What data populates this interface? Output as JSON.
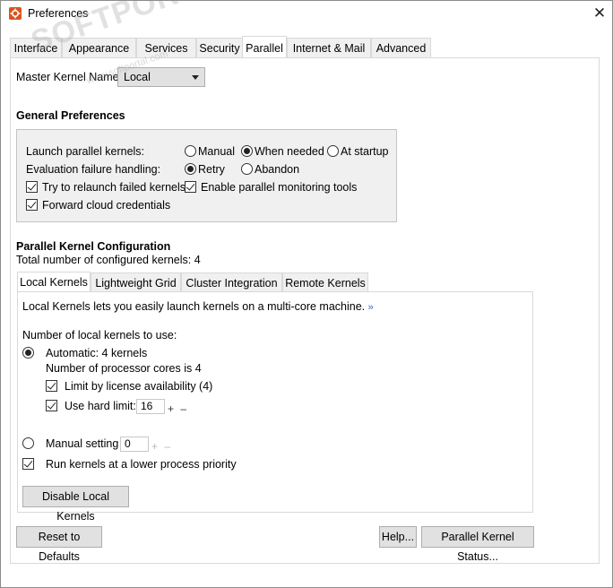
{
  "window": {
    "title": "Preferences",
    "close_glyph": "✕"
  },
  "tabs": [
    {
      "label": "Interface"
    },
    {
      "label": "Appearance"
    },
    {
      "label": "Services"
    },
    {
      "label": "Security"
    },
    {
      "label": "Parallel"
    },
    {
      "label": "Internet & Mail"
    },
    {
      "label": "Advanced"
    }
  ],
  "active_tab": "Parallel",
  "master_kernel": {
    "label": "Master Kernel Name:",
    "value": "Local"
  },
  "general": {
    "heading": "General Preferences",
    "launch_label": "Launch parallel kernels:",
    "launch_options": [
      "Manual",
      "When needed",
      "At startup"
    ],
    "launch_selected": "When needed",
    "failure_label": "Evaluation failure handling:",
    "failure_options": [
      "Retry",
      "Abandon"
    ],
    "failure_selected": "Retry",
    "relaunch_label": "Try to relaunch failed kernels",
    "relaunch_checked": true,
    "monitoring_label": "Enable parallel monitoring tools",
    "monitoring_checked": true,
    "cloud_label": "Forward cloud credentials",
    "cloud_checked": true
  },
  "config": {
    "heading": "Parallel Kernel Configuration",
    "total_text": "Total number of configured kernels: 4",
    "sub_tabs": [
      {
        "label": "Local Kernels"
      },
      {
        "label": "Lightweight Grid"
      },
      {
        "label": "Cluster Integration"
      },
      {
        "label": "Remote Kernels"
      }
    ],
    "active_sub_tab": "Local Kernels"
  },
  "local": {
    "description": "Local Kernels lets you easily launch kernels on a multi-core machine.",
    "more_glyph": "»",
    "number_label": "Number of local kernels to use:",
    "automatic_label": "Automatic: 4 kernels",
    "automatic_selected": true,
    "cores_text": "Number of processor cores is 4",
    "license_label": "Limit by license availability (4)",
    "license_checked": true,
    "hard_limit_label": "Use hard limit:",
    "hard_limit_checked": true,
    "hard_limit_value": "16",
    "stepper_glyph": "+ –",
    "manual_label": "Manual setting",
    "manual_selected": false,
    "manual_value": "0",
    "lower_priority_label": "Run kernels at a lower process priority",
    "lower_priority_checked": true,
    "disable_button": "Disable Local Kernels"
  },
  "footer": {
    "reset_button": "Reset to Defaults",
    "help_button": "Help...",
    "status_button": "Parallel Kernel Status..."
  },
  "watermark": {
    "text": "SOFTPORTAL",
    "sub": "www.softportal.com"
  },
  "colors": {
    "accent_link": "#3366cc",
    "app_icon": "#d9531e"
  }
}
